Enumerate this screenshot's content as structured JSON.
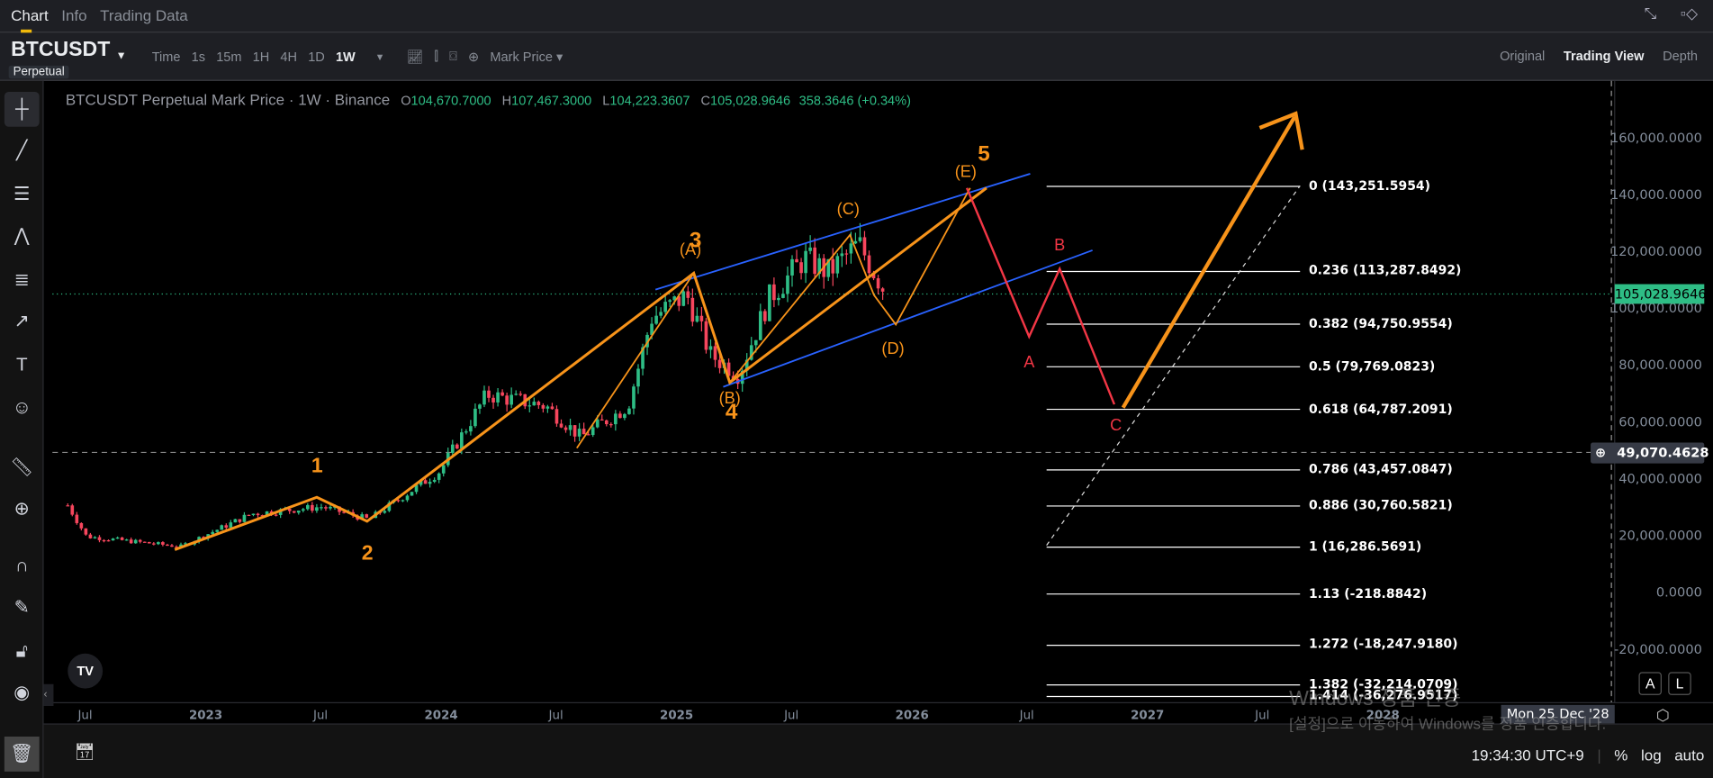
{
  "tabs": [
    "Chart",
    "Info",
    "Trading Data"
  ],
  "symbol": "BTCUSDT",
  "contract": "Perpetual",
  "intervals": [
    "Time",
    "1s",
    "15m",
    "1H",
    "4H",
    "1D",
    "1W"
  ],
  "active_interval": "1W",
  "price_type": "Mark Price",
  "views": [
    "Original",
    "Trading View",
    "Depth"
  ],
  "active_view": "Trading View",
  "legend": {
    "title": "BTCUSDT Perpetual Mark Price · 1W · Binance",
    "o_label": "O",
    "o": "104,670.7000",
    "h_label": "H",
    "h": "107,467.3000",
    "l_label": "L",
    "l": "104,223.3607",
    "c_label": "C",
    "c": "105,028.9646",
    "change": "358.3646 (+0.34%)"
  },
  "colors": {
    "up": "#2ebd85",
    "down": "#f6465d",
    "accent": "#f0b90b",
    "wave": "#f7931a",
    "channel": "#2962ff",
    "corr": "#f23645"
  },
  "chart_data": {
    "type": "candlestick",
    "title": "BTCUSDT Perpetual Mark Price · 1W · Binance",
    "y_ticks": [
      "160,000.0000",
      "140,000.0000",
      "120,000.0000",
      "100,000.0000",
      "80,000.0000",
      "60,000.0000",
      "40,000.0000",
      "20,000.0000",
      "0.0000",
      "-20,000.0000"
    ],
    "y_tick_values": [
      160000,
      140000,
      120000,
      100000,
      80000,
      60000,
      40000,
      20000,
      0,
      -20000
    ],
    "x_ticks": [
      "Jul",
      "2023",
      "Jul",
      "2024",
      "Jul",
      "2025",
      "Jul",
      "2026",
      "Jul",
      "2027",
      "Jul",
      "2028"
    ],
    "x_tick_years": [
      2022.5,
      2023,
      2023.5,
      2024,
      2024.5,
      2025,
      2025.5,
      2026,
      2026.5,
      2027,
      2027.5,
      2028
    ],
    "price_path_approx": [
      [
        2022.42,
        31000
      ],
      [
        2022.5,
        20000
      ],
      [
        2022.9,
        16500
      ],
      [
        2023.2,
        28000
      ],
      [
        2023.5,
        30500
      ],
      [
        2023.7,
        26000
      ],
      [
        2024.0,
        43000
      ],
      [
        2024.2,
        70000
      ],
      [
        2024.45,
        66000
      ],
      [
        2024.6,
        55000
      ],
      [
        2024.8,
        66000
      ],
      [
        2024.9,
        97000
      ],
      [
        2025.05,
        105000
      ],
      [
        2025.15,
        84000
      ],
      [
        2025.27,
        77000
      ],
      [
        2025.4,
        104000
      ],
      [
        2025.55,
        118000
      ],
      [
        2025.65,
        113000
      ],
      [
        2025.78,
        123000
      ],
      [
        2025.9,
        105000
      ]
    ],
    "current_price": "105,028.9646",
    "crosshair_price": "49,070.4628",
    "crosshair_date": "Mon 25 Dec '28",
    "fib_levels": [
      {
        "level": "0",
        "price": "143,251.5954",
        "v": 143251.5954
      },
      {
        "level": "0.236",
        "price": "113,287.8492",
        "v": 113287.8492
      },
      {
        "level": "0.382",
        "price": "94,750.9554",
        "v": 94750.9554
      },
      {
        "level": "0.5",
        "price": "79,769.0823",
        "v": 79769.0823
      },
      {
        "level": "0.618",
        "price": "64,787.2091",
        "v": 64787.2091
      },
      {
        "level": "0.786",
        "price": "43,457.0847",
        "v": 43457.0847
      },
      {
        "level": "0.886",
        "price": "30,760.5821",
        "v": 30760.5821
      },
      {
        "level": "1",
        "price": "16,286.5691",
        "v": 16286.5691
      },
      {
        "level": "1.13",
        "price": "-218.8842",
        "v": -218.8842
      },
      {
        "level": "1.272",
        "price": "-18,247.9180",
        "v": -18247.918
      },
      {
        "level": "1.382",
        "price": "-32,214.0709",
        "v": -32214.0709
      },
      {
        "level": "1.414",
        "price": "-36,276.9517",
        "v": -36276.9517
      }
    ],
    "wave_labels": [
      "1",
      "2",
      "3",
      "4",
      "5",
      "(A)",
      "(B)",
      "(C)",
      "(D)",
      "(E)",
      "A",
      "B",
      "C"
    ]
  },
  "axis_buttons": {
    "auto": "A",
    "log": "L"
  },
  "bottom": {
    "time": "19:34:30 UTC+9",
    "percent": "%",
    "log": "log",
    "auto": "auto"
  },
  "watermark": {
    "line1": "Windows 정품 인증",
    "line2": "[설정]으로 이동하여 Windows를 정품 인증합니다."
  },
  "logo": "TV"
}
